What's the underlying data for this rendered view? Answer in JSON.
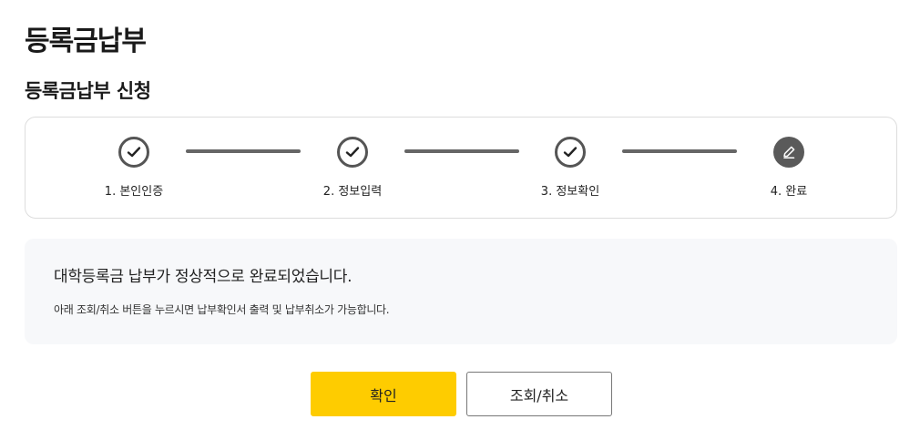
{
  "header": {
    "title": "등록금납부",
    "section_title": "등록금납부 신청"
  },
  "stepper": {
    "steps": [
      {
        "label": "1. 본인인증",
        "status": "done",
        "icon": "check-icon"
      },
      {
        "label": "2. 정보입력",
        "status": "done",
        "icon": "check-icon"
      },
      {
        "label": "3. 정보확인",
        "status": "done",
        "icon": "check-icon"
      },
      {
        "label": "4. 완료",
        "status": "current",
        "icon": "pencil-icon"
      }
    ]
  },
  "message": {
    "main": "대학등록금 납부가 정상적으로 완료되었습니다.",
    "sub": "아래 조회/취소 버튼을 누르시면 납부확인서 출력 및 납부취소가 가능합니다."
  },
  "buttons": {
    "confirm_label": "확인",
    "lookup_cancel_label": "조회/취소"
  },
  "colors": {
    "primary": "#fecc00",
    "step_active": "#555555",
    "panel_bg": "#f7f8fa"
  }
}
